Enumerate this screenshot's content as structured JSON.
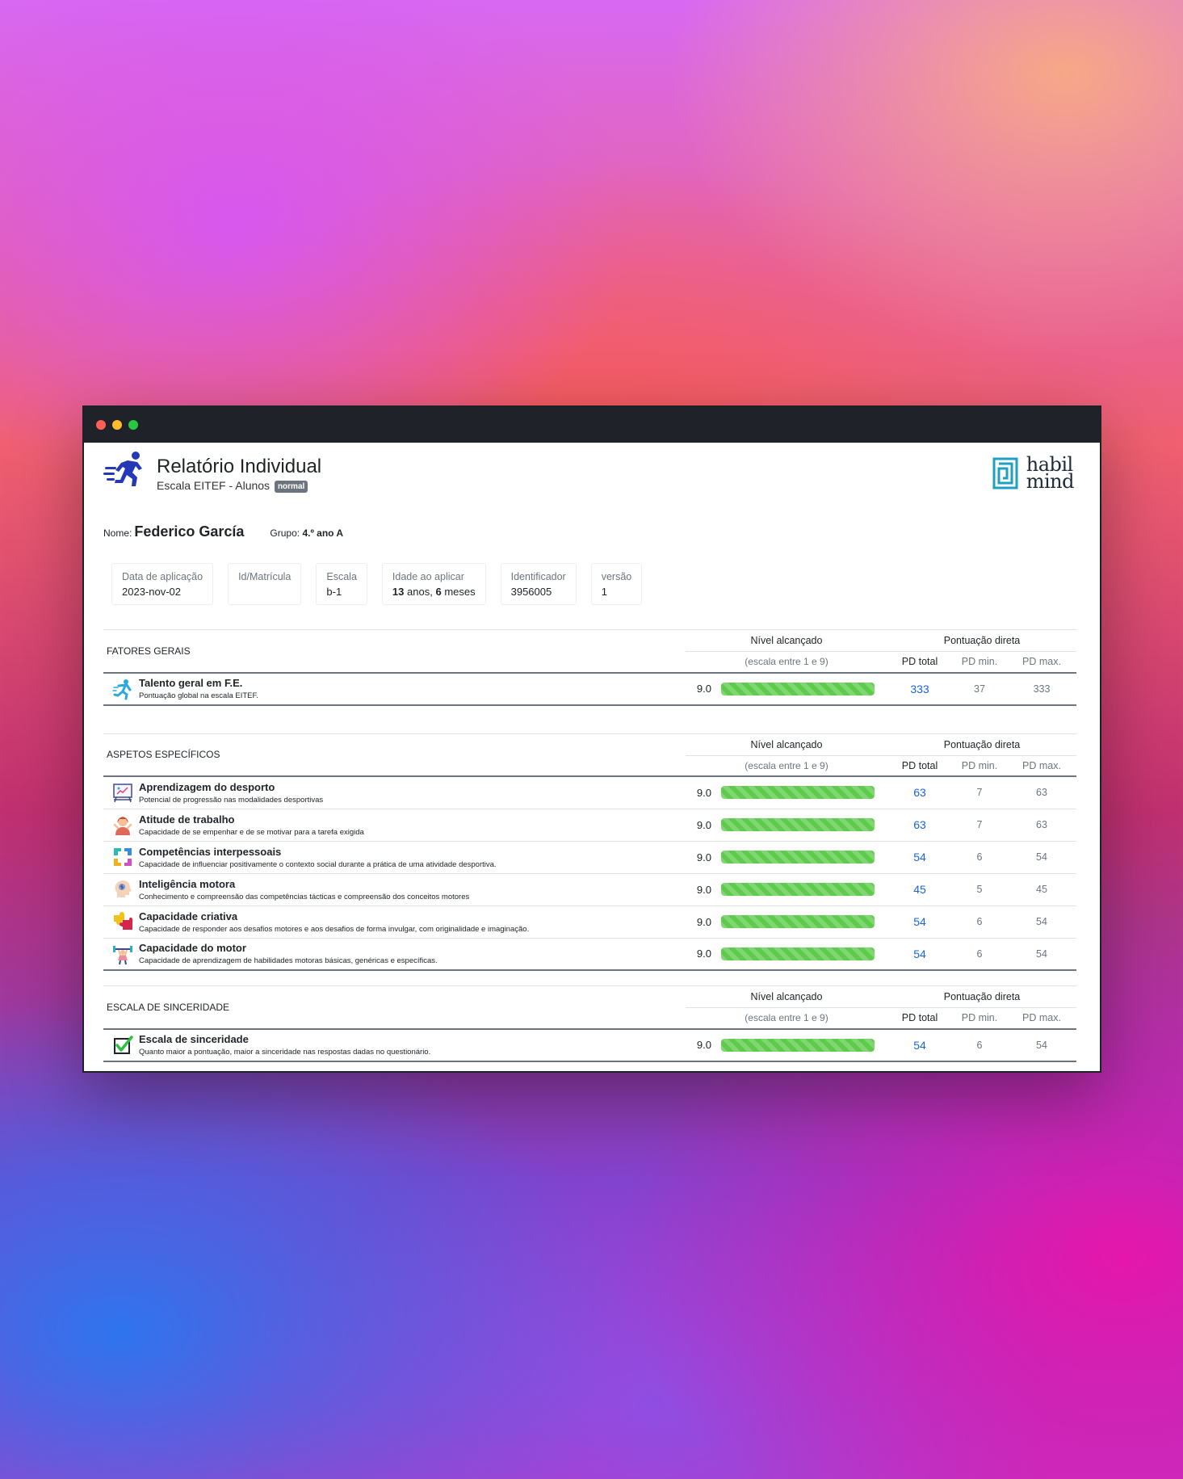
{
  "report": {
    "title": "Relatório Individual",
    "subtitle": "Escala EITEF - Alunos",
    "badge": "normal",
    "brand_line1": "habil",
    "brand_line2": "mind"
  },
  "person": {
    "name_label": "Nome:",
    "name": "Federico García",
    "group_label": "Grupo:",
    "group": "4.º ano A"
  },
  "info_cards": [
    {
      "label": "Data de aplicação",
      "value": "2023-nov-02"
    },
    {
      "label": "Id/Matrícula",
      "value": ""
    },
    {
      "label": "Escala",
      "value": "b-1"
    },
    {
      "label": "Idade ao aplicar",
      "years": "13",
      "years_unit": "anos,",
      "months": "6",
      "months_unit": "meses"
    },
    {
      "label": "Identificador",
      "value": "3956005"
    },
    {
      "label": "versão",
      "value": "1"
    }
  ],
  "table_headers": {
    "level": "Nível alcançado",
    "scale_note": "(escala entre 1 e 9)",
    "direct": "Pontuação direta",
    "pd_total": "PD total",
    "pd_min": "PD min.",
    "pd_max": "PD max."
  },
  "sections": [
    {
      "title": "FATORES GERAIS",
      "rows": [
        {
          "icon": "runner-figure-icon",
          "title": "Talento geral em F.E.",
          "desc": "Pontuação global na escala EITEF.",
          "level": "9.0",
          "level_fraction": 1.0,
          "pd_total": "333",
          "pd_min": "37",
          "pd_max": "333"
        }
      ]
    },
    {
      "title": "ASPETOS ESPECÍFICOS",
      "rows": [
        {
          "icon": "whiteboard-icon",
          "title": "Aprendizagem do desporto",
          "desc": "Potencial de progressão nas modalidades desportivas",
          "level": "9.0",
          "level_fraction": 1.0,
          "pd_total": "63",
          "pd_min": "7",
          "pd_max": "63"
        },
        {
          "icon": "stressed-person-icon",
          "title": "Atitude de trabalho",
          "desc": "Capacidade de se empenhar e de se motivar para a tarefa exigida",
          "level": "9.0",
          "level_fraction": 1.0,
          "pd_total": "63",
          "pd_min": "7",
          "pd_max": "63"
        },
        {
          "icon": "puzzle-arrows-icon",
          "title": "Competências interpessoais",
          "desc": "Capacidade de influenciar positivamente o contexto social durante a prática de uma atividade desportiva.",
          "level": "9.0",
          "level_fraction": 1.0,
          "pd_total": "54",
          "pd_min": "6",
          "pd_max": "54"
        },
        {
          "icon": "head-brain-icon",
          "title": "Inteligência motora",
          "desc": "Conhecimento e compreensão das competências tácticas e compreensão dos conceitos motores",
          "level": "9.0",
          "level_fraction": 1.0,
          "pd_total": "45",
          "pd_min": "5",
          "pd_max": "45"
        },
        {
          "icon": "puzzle-pieces-icon",
          "title": "Capacidade criativa",
          "desc": "Capacidade de responder aos desafios motores e aos desafios de forma invulgar, com originalidade e imaginação.",
          "level": "9.0",
          "level_fraction": 1.0,
          "pd_total": "54",
          "pd_min": "6",
          "pd_max": "54"
        },
        {
          "icon": "weightlifter-icon",
          "title": "Capacidade do motor",
          "desc": "Capacidade de aprendizagem de habilidades motoras básicas, genéricas e específicas.",
          "level": "9.0",
          "level_fraction": 1.0,
          "pd_total": "54",
          "pd_min": "6",
          "pd_max": "54"
        }
      ]
    },
    {
      "title": "ESCALA DE SINCERIDADE",
      "rows": [
        {
          "icon": "checkbox-checked-icon",
          "title": "Escala de sinceridade",
          "desc": "Quanto maior a pontuação, maior a sinceridade nas respostas dadas no questionário.",
          "level": "9.0",
          "level_fraction": 1.0,
          "pd_total": "54",
          "pd_min": "6",
          "pd_max": "54"
        }
      ]
    }
  ],
  "colors": {
    "bar_fill": "#5ccc4a",
    "pd_total": "#1a63d8",
    "brand_teal": "#1ea0c4",
    "runner_blue": "#2438b8"
  }
}
